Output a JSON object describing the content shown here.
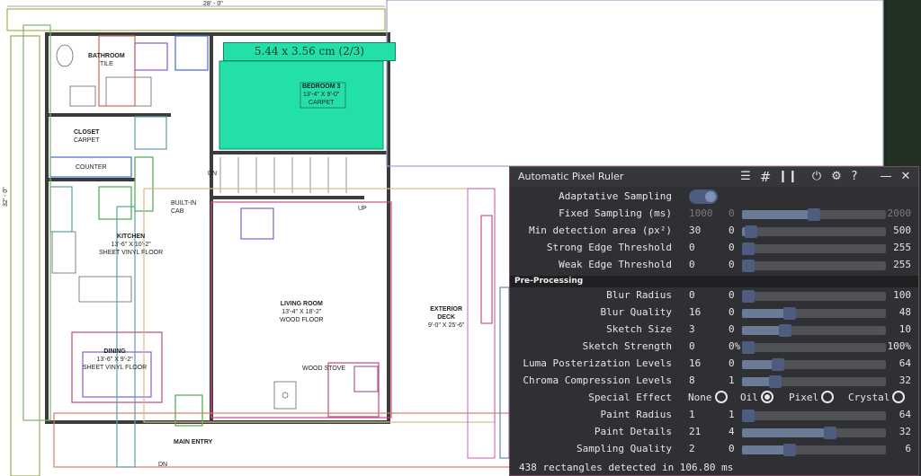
{
  "plan": {
    "top_dim": "28' - 0\"",
    "side_dim": "32' - 0\"",
    "measure_label": "5.44 x 3.56 cm (2/3)",
    "rooms": {
      "bathroom_name": "BATHROOM",
      "bathroom_floor": "TILE",
      "closet_name": "CLOSET",
      "closet_floor": "CARPET",
      "counter": "COUNTER",
      "builtin": "BUILT-IN",
      "builtin2": "CAB",
      "kitchen_name": "KITCHEN",
      "kitchen_dim": "13'-6\" X 10'-2\"",
      "kitchen_floor": "SHEET VINYL FLOOR",
      "dining_name": "DINING",
      "dining_dim": "13'-6\" X 9'-2\"",
      "dining_floor": "SHEET VINYL FLOOR",
      "bedroom_name": "BEDROOM 3",
      "bedroom_dim": "13'-4\" X 9'-0\"",
      "bedroom_floor": "CARPET",
      "living_name": "LIVING ROOM",
      "living_dim": "13'-4\" X 18'-2\"",
      "living_floor": "WOOD FLOOR",
      "stove": "WOOD STOVE",
      "deck_name": "EXTERIOR",
      "deck_name2": "DECK",
      "deck_dim": "9'-0\" X 25'-6\"",
      "main_entry": "MAIN ENTRY",
      "dn1": "DN",
      "dn2": "DN",
      "up": "UP"
    }
  },
  "panel": {
    "title": "Automatic Pixel Ruler",
    "icons": [
      "filter-icon",
      "grid-icon",
      "pause-icon",
      "power-icon",
      "gear-icon",
      "help-icon",
      "minimize-icon",
      "close-icon"
    ],
    "section_label": "Pre-Processing",
    "status": "438 rectangles detected in 106.80 ms",
    "rows": [
      {
        "label": "Adaptative Sampling",
        "kind": "toggle",
        "on": true
      },
      {
        "label": "Fixed Sampling (ms)",
        "v": "1000",
        "min": "0",
        "max": "2000",
        "fraction": 0.5,
        "disabled": true
      },
      {
        "label": "Min detection area (px²)",
        "v": "30",
        "min": "0",
        "max": "500",
        "fraction": 0.06
      },
      {
        "label": "Strong Edge Threshold",
        "v": "0",
        "min": "0",
        "max": "255",
        "fraction": 0.0
      },
      {
        "label": "Weak Edge Threshold",
        "v": "0",
        "min": "0",
        "max": "255",
        "fraction": 0.0
      },
      {
        "label": "Blur Radius",
        "v": "0",
        "min": "0",
        "max": "100",
        "fraction": 0.0
      },
      {
        "label": "Blur Quality",
        "v": "16",
        "min": "0",
        "max": "48",
        "fraction": 0.33
      },
      {
        "label": "Sketch Size",
        "v": "3",
        "min": "0",
        "max": "10",
        "fraction": 0.3
      },
      {
        "label": "Sketch Strength",
        "v": "0",
        "min": "0%",
        "max": "100%",
        "fraction": 0.0
      },
      {
        "label": "Luma Posterization Levels",
        "v": "16",
        "min": "0",
        "max": "64",
        "fraction": 0.25
      },
      {
        "label": "Chroma Compression Levels",
        "v": "8",
        "min": "1",
        "max": "32",
        "fraction": 0.23
      },
      {
        "label": "Special Effect",
        "kind": "radio",
        "options": [
          "None",
          "Oil",
          "Pixel",
          "Crystal"
        ],
        "selected": "Oil"
      },
      {
        "label": "Paint Radius",
        "v": "1",
        "min": "1",
        "max": "64",
        "fraction": 0.0
      },
      {
        "label": "Paint Details",
        "v": "21",
        "min": "4",
        "max": "32",
        "fraction": 0.61
      },
      {
        "label": "Sampling Quality",
        "v": "2",
        "min": "0",
        "max": "6",
        "fraction": 0.33
      }
    ]
  },
  "colors": {
    "panel_bg": "#2f3033",
    "accent": "#4d5c7f",
    "highlight": "#22e0a8"
  }
}
